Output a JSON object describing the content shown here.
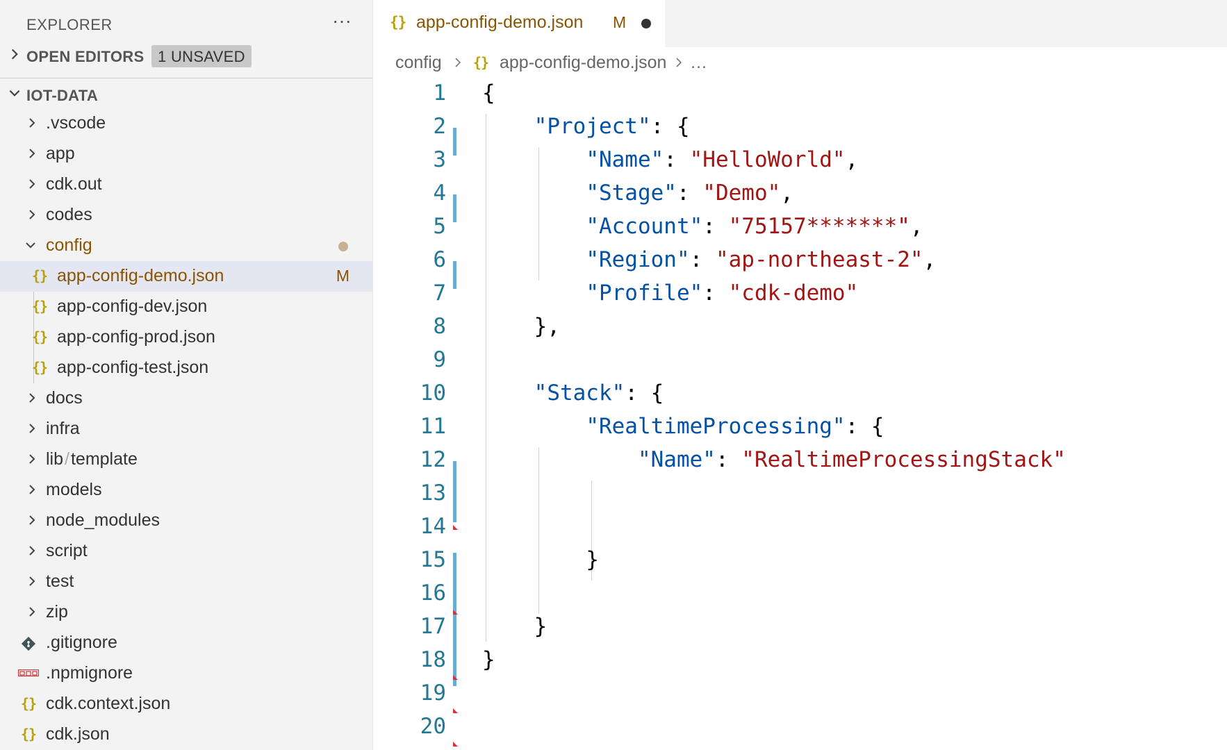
{
  "explorer": {
    "title": "EXPLORER",
    "more": "···",
    "open_editors": {
      "label": "OPEN EDITORS",
      "badge": "1 UNSAVED"
    },
    "root": {
      "label": "IOT-DATA"
    },
    "tree": [
      {
        "name": ".vscode"
      },
      {
        "name": "app"
      },
      {
        "name": "cdk.out"
      },
      {
        "name": "codes"
      },
      {
        "name": "config",
        "status": "●"
      },
      {
        "name": "app-config-demo.json",
        "status": "M"
      },
      {
        "name": "app-config-dev.json"
      },
      {
        "name": "app-config-prod.json"
      },
      {
        "name": "app-config-test.json"
      },
      {
        "name": "docs"
      },
      {
        "name": "infra"
      },
      {
        "name": "lib",
        "sub": "template",
        "sep": "/"
      },
      {
        "name": "models"
      },
      {
        "name": "node_modules"
      },
      {
        "name": "script"
      },
      {
        "name": "test"
      },
      {
        "name": "zip"
      },
      {
        "name": ".gitignore"
      },
      {
        "name": ".npmignore"
      },
      {
        "name": "cdk.context.json"
      },
      {
        "name": "cdk.json"
      }
    ],
    "json_icon": "{}"
  },
  "editor": {
    "tab": {
      "icon": "{}",
      "label": "app-config-demo.json",
      "status": "M"
    },
    "breadcrumb": {
      "folder": "config",
      "icon": "{}",
      "file": "app-config-demo.json",
      "more": "…"
    },
    "code": {
      "line_numbers": [
        "1",
        "2",
        "3",
        "4",
        "5",
        "6",
        "7",
        "8",
        "9",
        "10",
        "11",
        "12",
        "13",
        "14",
        "15",
        "16",
        "17",
        "18",
        "19",
        "20"
      ],
      "tokens": {
        "l1": "{",
        "l2k": "\"Project\"",
        "l2p": ": {",
        "l3k": "\"Name\"",
        "l3c": ": ",
        "l3v": "\"HelloWorld\"",
        "l3e": ",",
        "l4k": "\"Stage\"",
        "l4c": ": ",
        "l4v": "\"Demo\"",
        "l4e": ",",
        "l5k": "\"Account\"",
        "l5c": ": ",
        "l5v": "\"75157*******\"",
        "l5e": ",",
        "l6k": "\"Region\"",
        "l6c": ": ",
        "l6v": "\"ap-northeast-2\"",
        "l6e": ",",
        "l7k": "\"Profile\"",
        "l7c": ": ",
        "l7v": "\"cdk-demo\"",
        "l8": "},",
        "l10k": "\"Stack\"",
        "l10p": ": {",
        "l11k": "\"RealtimeProcessing\"",
        "l11p": ": {",
        "l12k": "\"Name\"",
        "l12c": ": ",
        "l12v": "\"RealtimeProcessingStack\"",
        "l15": "}",
        "l17": "}",
        "l18": "}"
      }
    }
  },
  "colors": {
    "key": "#0451a5",
    "string": "#a31515",
    "line_number": "#237893",
    "modified": "#895503",
    "gutter_added": "#69add4",
    "gutter_deleted": "#d4333b"
  }
}
